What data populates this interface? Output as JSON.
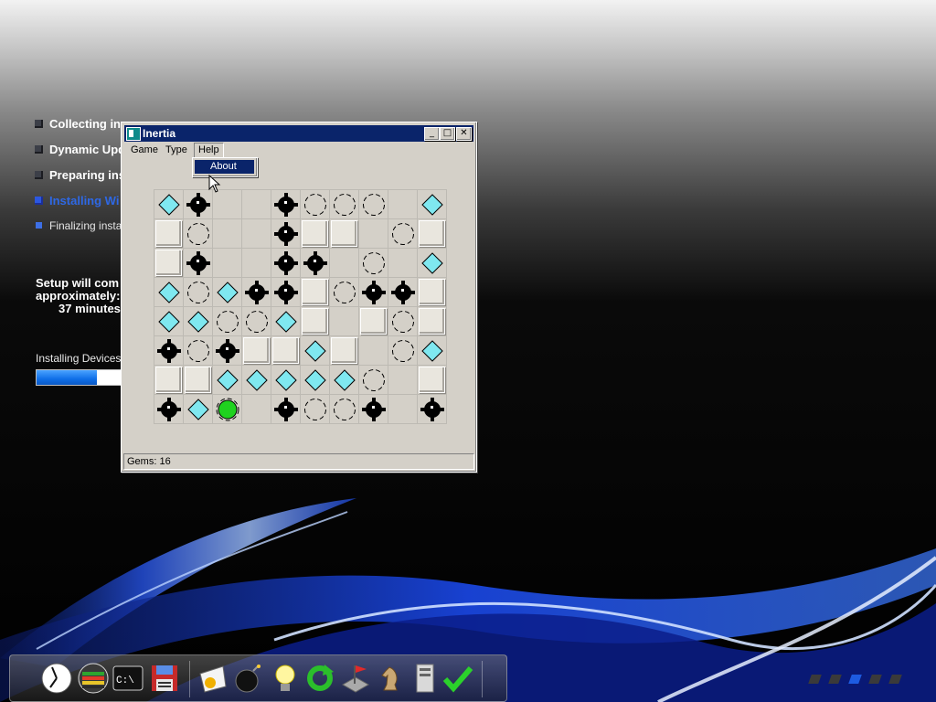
{
  "setup": {
    "steps": [
      {
        "label": "Collecting in",
        "state": "done"
      },
      {
        "label": "Dynamic Upd",
        "state": "done"
      },
      {
        "label": "Preparing ins",
        "state": "done"
      },
      {
        "label": "Installing Wi",
        "state": "active"
      },
      {
        "label": "Finalizing instal",
        "state": "pending"
      }
    ],
    "time_line1": "Setup will com",
    "time_line2": "approximately:",
    "time_line3": "37 minutes",
    "installing_label": "Installing Devices",
    "progress_fraction": 0.55
  },
  "window": {
    "title": "Inertia",
    "buttons": {
      "minimize": "_",
      "maximize": "□",
      "close": "✕"
    },
    "menu": [
      "Game",
      "Type",
      "Help"
    ],
    "open_menu": "Help",
    "dropdown_items": [
      "About"
    ],
    "status": "Gems: 16"
  },
  "board": {
    "cols": 10,
    "rows": 8,
    "legend": {
      "G": "gem",
      "M": "mine",
      "S": "stop",
      "W": "wall",
      "P": "player",
      ".": "empty"
    },
    "grid": [
      "GM..MSSS.G",
      "WS..MWW.SW",
      "WM..MM.S.G",
      "GSGMMWSMMW",
      "GGSSGW.WSW",
      "MSMWWGW.SG",
      "WWGGGGGS.W",
      "MGP.MSSM.M"
    ],
    "colors": {
      "gem": "#7fe8f0",
      "player": "#1fd21f",
      "mine": "#000000",
      "wall": "#e9e6de",
      "cell": "#d4d0c8"
    }
  },
  "dock": {
    "icons": [
      "clock-icon",
      "network-meter-icon",
      "command-prompt-icon",
      "floppy-save-icon",
      "paint-icon",
      "bomb-icon",
      "lightbulb-icon",
      "refresh-icon",
      "flag-network-icon",
      "chess-knight-icon",
      "server-icon",
      "checkmark-icon"
    ]
  },
  "pager": {
    "count": 5,
    "active_index": 2
  }
}
